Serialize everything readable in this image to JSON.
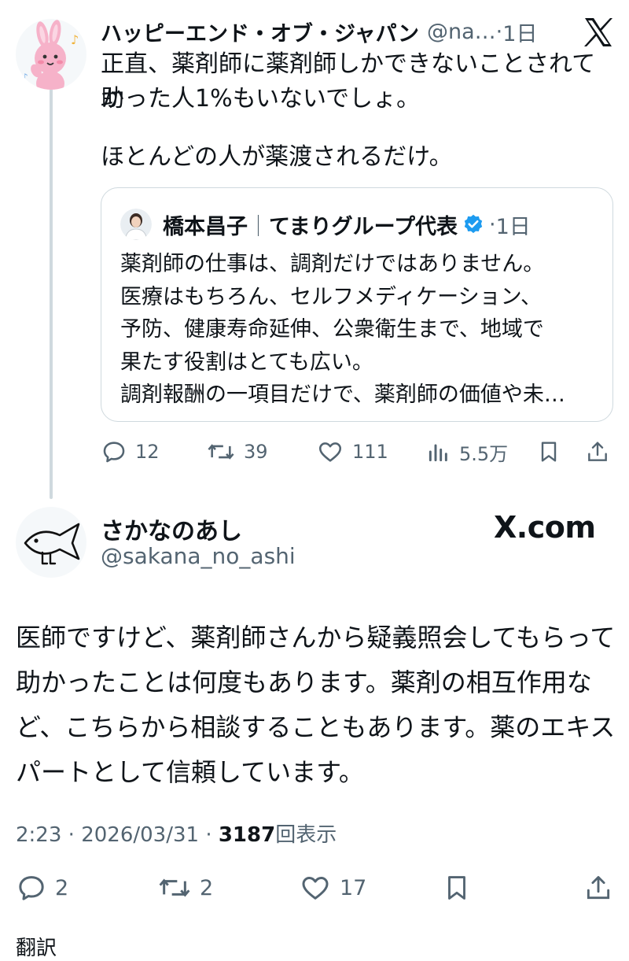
{
  "colors": {
    "text": "#0f1419",
    "secondary": "#536471",
    "border": "#cfd9de",
    "verified": "#1d9bf0",
    "avatar_pink": "#f6b2c9"
  },
  "screenshot_tweet": {
    "author_name": "ハッピーエンド・オブ・ジャパン",
    "author_handle": "@na…",
    "time_sep": "·",
    "time": "1日",
    "text_lines": [
      "正直、薬剤師に薬剤師しかできないことされて助",
      "かった人1%もいないでしょ。",
      "",
      "ほとんどの人が薬渡されるだけ。"
    ],
    "platform_icon": "x-logo",
    "quote": {
      "author_name": "橋本昌子",
      "separator": "｜",
      "author_title": "てまりグループ代表",
      "time_sep": "·",
      "time": "1日",
      "text": "薬剤師の仕事は、調剤だけではありません。\n医療はもちろん、セルフメディケーション、\n予防、健康寿命延伸、公衆衛生まで、地域で\n果たす役割はとても広い。\n調剤報酬の一項目だけで、薬剤師の価値や未…"
    },
    "actions": {
      "replies": "12",
      "retweets": "39",
      "likes": "111",
      "views": "5.5万"
    }
  },
  "reply_tweet": {
    "author_name": "さかなのあし",
    "author_handle": "@sakana_no_ashi",
    "site_label": "X.com",
    "text": "医師ですけど、薬剤師さんから疑義照会してもらって助かったことは何度もあります。薬剤の相互作用など、こちらから相談することもあります。薬のエキスパートとして信頼しています。",
    "time": "2:23",
    "sep1": "·",
    "date": "2026/03/31",
    "sep2": "·",
    "views_count": "3187",
    "views_label": "回表示",
    "actions": {
      "replies": "2",
      "retweets": "2",
      "likes": "17"
    }
  },
  "next_peek": "翻訳"
}
